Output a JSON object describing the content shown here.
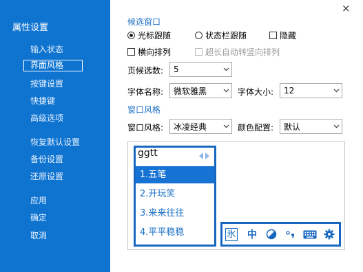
{
  "sidebar": {
    "title": "属性设置",
    "items": [
      {
        "label": "输入状态"
      },
      {
        "label": "界面风格"
      },
      {
        "label": "按键设置"
      },
      {
        "label": "快捷键"
      },
      {
        "label": "高级选项"
      },
      {
        "label": "恢复默认设置"
      },
      {
        "label": "备份设置"
      },
      {
        "label": "还原设置"
      },
      {
        "label": "应用"
      },
      {
        "label": "确定"
      },
      {
        "label": "取消"
      }
    ],
    "selected": "界面风格"
  },
  "window": {
    "close_icon": "×"
  },
  "candidate_window": {
    "section_title": "候选窗口",
    "follow_cursor": {
      "label": "光标跟随",
      "checked": true
    },
    "follow_statusbar": {
      "label": "状态栏跟随",
      "checked": false
    },
    "hide": {
      "label": "隐藏",
      "checked": false
    },
    "horizontal": {
      "label": "横向排列",
      "checked": false
    },
    "auto_vertical": {
      "label": "超长自动转竖向排列",
      "checked": false,
      "disabled": true
    },
    "page_count_label": "页候选数:",
    "page_count_value": "5",
    "font_name_label": "字体名称:",
    "font_name_value": "微软雅黑",
    "font_size_label": "字体大小:",
    "font_size_value": "12"
  },
  "window_style": {
    "section_title": "窗口风格",
    "style_label": "窗口风格:",
    "style_value": "冰凌经典",
    "color_label": "颜色配置:",
    "color_value": "默认"
  },
  "preview": {
    "code": "ggtt",
    "candidates": [
      "1.五笔",
      "2.开玩笑",
      "3.来来往往",
      "4.平平稳稳"
    ],
    "highlighted_index": 0,
    "toolbar_icons": [
      "ice-logo-icon",
      "chinese-mode-icon",
      "halfwidth-icon",
      "punctuation-icon",
      "keyboard-icon",
      "settings-icon"
    ],
    "toolbar_glyphs": {
      "logo": "氷",
      "mode": "中"
    },
    "accent_color": "#1667c0",
    "sidebar_color": "#0f74d0"
  }
}
